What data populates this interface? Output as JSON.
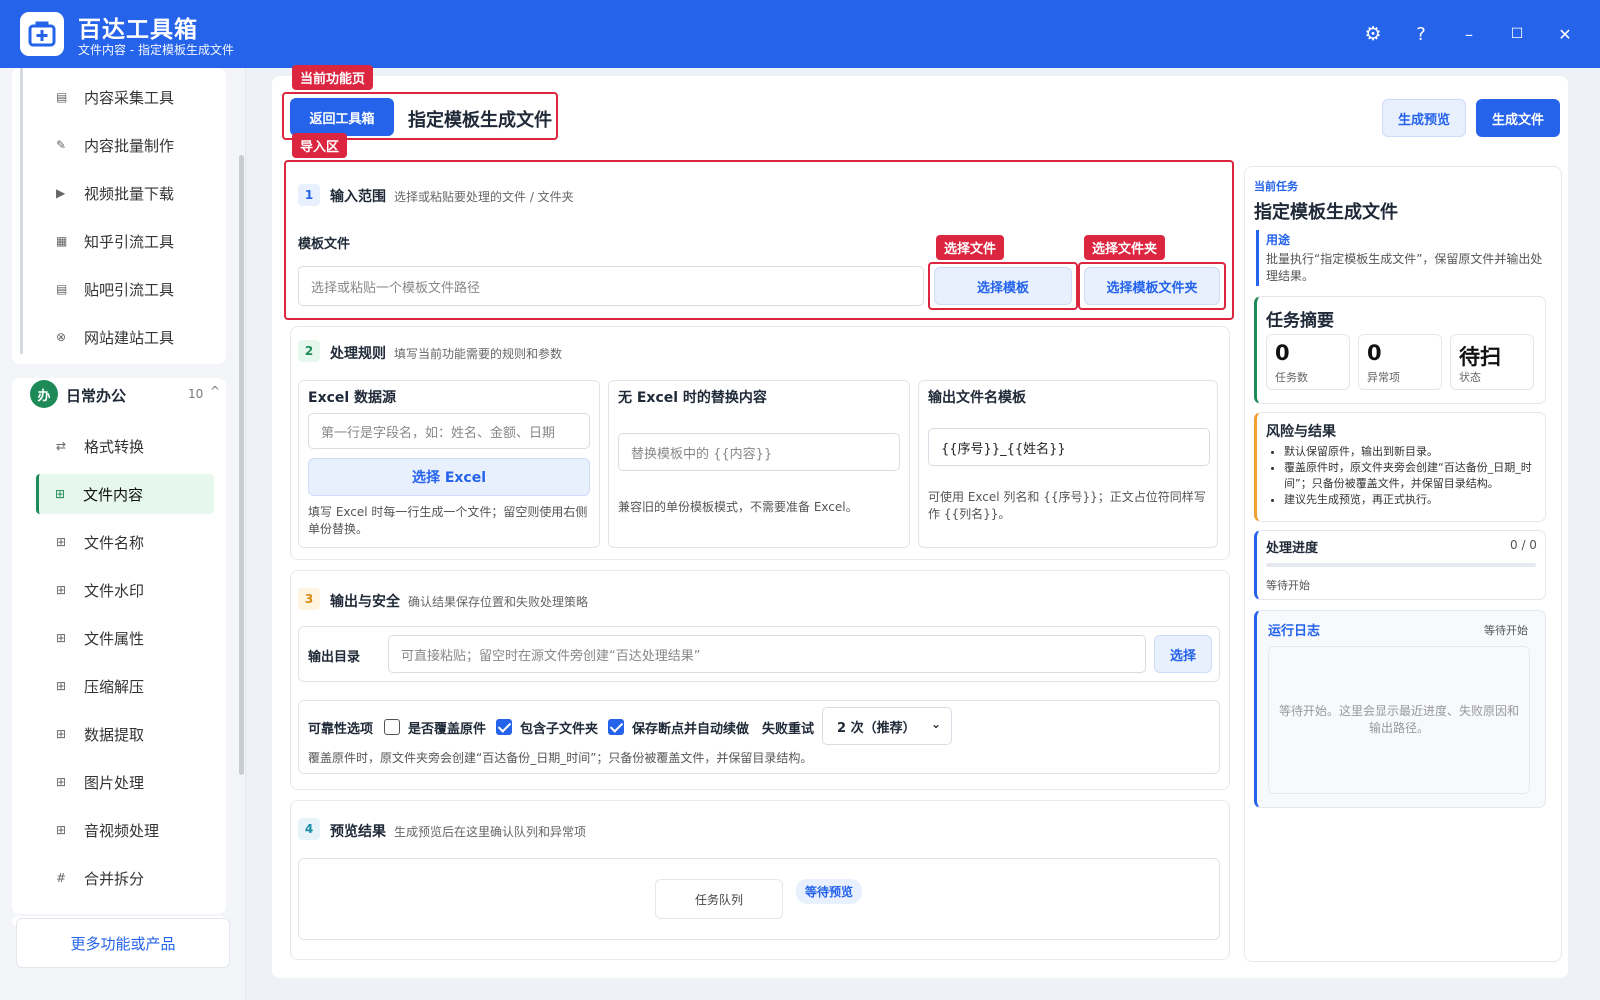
{
  "app": {
    "name": "百达工具箱",
    "subtitle": "文件内容 - 指定模板生成文件"
  },
  "window_controls": {
    "settings": "⚙",
    "help": "?",
    "minimize": "–",
    "maximize": "☐",
    "close": "✕"
  },
  "sidebar": {
    "group1_items": [
      {
        "label": "内容采集工具",
        "icon": "▤"
      },
      {
        "label": "内容批量制作",
        "icon": "✎"
      },
      {
        "label": "视频批量下载",
        "icon": "▶"
      },
      {
        "label": "知乎引流工具",
        "icon": "▦"
      },
      {
        "label": "贴吧引流工具",
        "icon": "▤"
      },
      {
        "label": "网站建站工具",
        "icon": "⊗"
      }
    ],
    "group2": {
      "badge": "办",
      "title": "日常办公",
      "count": "10",
      "toggle": "^"
    },
    "group2_items": [
      {
        "label": "格式转换",
        "icon": "⇄"
      },
      {
        "label": "文件内容",
        "icon": "⊞",
        "active": true
      },
      {
        "label": "文件名称",
        "icon": "⊞"
      },
      {
        "label": "文件水印",
        "icon": "⊞"
      },
      {
        "label": "文件属性",
        "icon": "⊞"
      },
      {
        "label": "压缩解压",
        "icon": "⊞"
      },
      {
        "label": "数据提取",
        "icon": "⊞"
      },
      {
        "label": "图片处理",
        "icon": "⊞"
      },
      {
        "label": "音视频处理",
        "icon": "⊞"
      },
      {
        "label": "合并拆分",
        "icon": "#"
      }
    ],
    "more": "更多功能或产品"
  },
  "annotations": {
    "current_page": "当前功能页",
    "import_area": "导入区",
    "select_file": "选择文件",
    "select_folder": "选择文件夹"
  },
  "header": {
    "back_label": "返回工具箱",
    "title": "指定模板生成文件",
    "preview_label": "生成预览",
    "generate_label": "生成文件"
  },
  "section1": {
    "num": "1",
    "title": "输入范围",
    "desc": "选择或粘贴要处理的文件 / 文件夹",
    "field_label": "模板文件",
    "placeholder": "选择或粘贴一个模板文件路径",
    "btn_template": "选择模板",
    "btn_folder": "选择模板文件夹"
  },
  "section2": {
    "num": "2",
    "title": "处理规则",
    "desc": "填写当前功能需要的规则和参数",
    "excel": {
      "title": "Excel 数据源",
      "placeholder": "第一行是字段名，如：姓名、金额、日期",
      "button": "选择 Excel",
      "hint": "填写 Excel 时每一行生成一个文件；留空则使用右侧单份替换。"
    },
    "no_excel": {
      "title": "无 Excel 时的替换内容",
      "placeholder": "替换模板中的 {{内容}}",
      "hint": "兼容旧的单份模板模式，不需要准备 Excel。"
    },
    "filename": {
      "title": "输出文件名模板",
      "value": "{{序号}}_{{姓名}}",
      "hint": "可使用 Excel 列名和 {{序号}}；正文占位符同样写作 {{列名}}。"
    }
  },
  "section3": {
    "num": "3",
    "title": "输出与安全",
    "desc": "确认结果保存位置和失败处理策略",
    "out_label": "输出目录",
    "out_placeholder": "可直接粘贴；留空时在源文件旁创建“百达处理结果”",
    "out_button": "选择",
    "opt_label": "可靠性选项",
    "opt_overwrite": "是否覆盖原件",
    "opt_subfolder": "包含子文件夹",
    "opt_resume": "保存断点并自动续做",
    "retry_label": "失败重试",
    "retry_value": "2 次（推荐）",
    "note": "覆盖原件时，原文件夹旁会创建“百达备份_日期_时间”；只备份被覆盖文件，并保留目录结构。"
  },
  "section4": {
    "num": "4",
    "title": "预览结果",
    "desc": "生成预览后在这里确认队列和异常项",
    "queue_label": "任务队列",
    "queue_status": "等待预览"
  },
  "right": {
    "current_label": "当前任务",
    "current_title": "指定模板生成文件",
    "usage_label": "用途",
    "usage_text": "批量执行“指定模板生成文件”，保留原文件并输出处理结果。",
    "summary_title": "任务摘要",
    "stats": [
      {
        "value": "0",
        "label": "任务数"
      },
      {
        "value": "0",
        "label": "异常项"
      },
      {
        "value": "待扫",
        "label": "状态"
      }
    ],
    "risk_title": "风险与结果",
    "risk_items": [
      "默认保留原件，输出到新目录。",
      "覆盖原件时，原文件夹旁会创建“百达备份_日期_时间”；只备份被覆盖文件，并保留目录结构。",
      "建议先生成预览，再正式执行。"
    ],
    "progress_title": "处理进度",
    "progress_count": "0 / 0",
    "progress_fraction": 0,
    "progress_status": "等待开始",
    "log_title": "运行日志",
    "log_status": "等待开始",
    "log_placeholder": "等待开始。这里会显示最近进度、失败原因和输出路径。"
  },
  "colors": {
    "primary": "#2563eb",
    "accent_green": "#1e8a57",
    "annotation_red": "#dc2640",
    "risk_orange": "#f0a030"
  }
}
